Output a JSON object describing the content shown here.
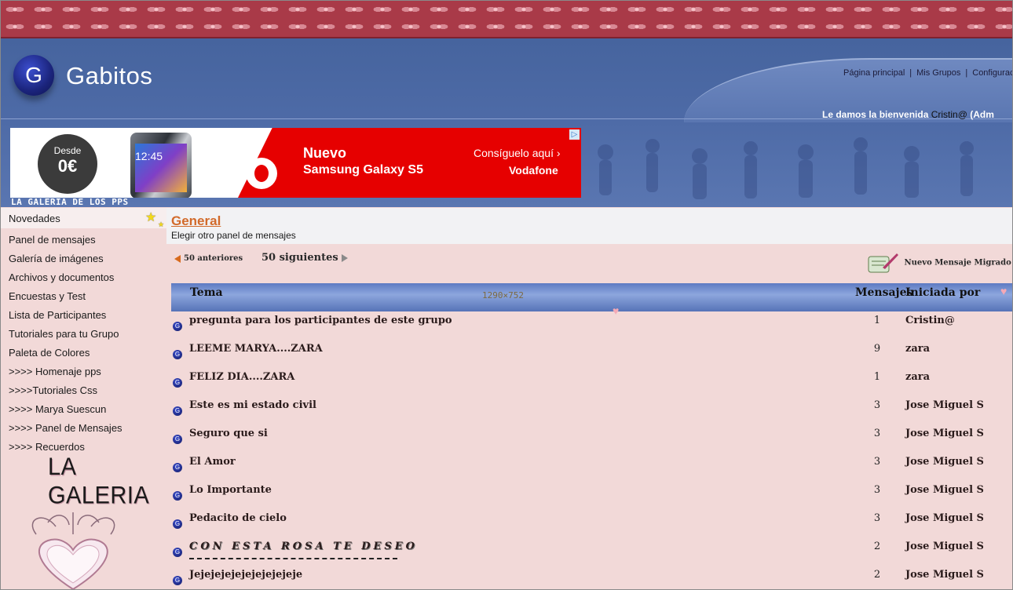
{
  "header": {
    "logo_letter": "G",
    "logo_text": "Gabitos",
    "links": [
      "Página principal",
      "Mis Grupos",
      "Configurac"
    ],
    "welcome_prefix": "Le damos la bienvenida",
    "welcome_user": "Cristin@",
    "welcome_role": "(Adm"
  },
  "ad": {
    "badge_small": "Desde",
    "badge_big": "0€",
    "phone_time": "12:45",
    "title1": "Nuevo",
    "title2": "Samsung Galaxy S5",
    "cta": "Consíguelo aquí ›",
    "brand": "Vodafone",
    "choice": "▷"
  },
  "group_title": "LA GALERIA DE LOS PPS",
  "sidebar": {
    "items": [
      "Novedades",
      "Panel de mensajes",
      "Galería de imágenes",
      "Archivos y documentos",
      "Encuestas y Test",
      "Lista de Participantes",
      "Tutoriales para tu Grupo",
      "Paleta de Colores",
      ">>>> Homenaje pps",
      ">>>>Tutoriales Css",
      ">>>> Marya Suescun",
      ">>>> Panel de Mensajes",
      ">>>> Recuerdos"
    ],
    "banner_text": "LA GALERIA"
  },
  "board": {
    "title": "General",
    "subtitle": "Elegir otro panel de mensajes",
    "prev_label": "50 anteriores",
    "next_label": "50 siguientes",
    "new_message_label": "Nuevo Mensaje Migrado",
    "size_label": "1290×752",
    "columns": {
      "subject": "Tema",
      "count": "Mensajes",
      "author": "Iniciada por"
    },
    "rows": [
      {
        "subject": "pregunta para los participantes de este grupo",
        "count": "1",
        "author": "Cristin@"
      },
      {
        "subject": "LEEME MARYA....ZARA",
        "count": "9",
        "author": "zara"
      },
      {
        "subject": "FELIZ DIA....ZARA",
        "count": "1",
        "author": "zara"
      },
      {
        "subject": "Este es mi estado civil",
        "count": "3",
        "author": "Jose Miguel S"
      },
      {
        "subject": "Seguro que si",
        "count": "3",
        "author": "Jose Miguel S"
      },
      {
        "subject": "El Amor",
        "count": "3",
        "author": "Jose Miguel S"
      },
      {
        "subject": "Lo Importante",
        "count": "3",
        "author": "Jose Miguel S"
      },
      {
        "subject": "Pedacito de cielo",
        "count": "3",
        "author": "Jose Miguel S"
      },
      {
        "subject": "CON  ESTA  ROSA  TE  DESEO",
        "count": "2",
        "author": "Jose Miguel S"
      },
      {
        "subject": "Jejejejejejejejejejeje",
        "count": "2",
        "author": "Jose Miguel S"
      }
    ]
  }
}
